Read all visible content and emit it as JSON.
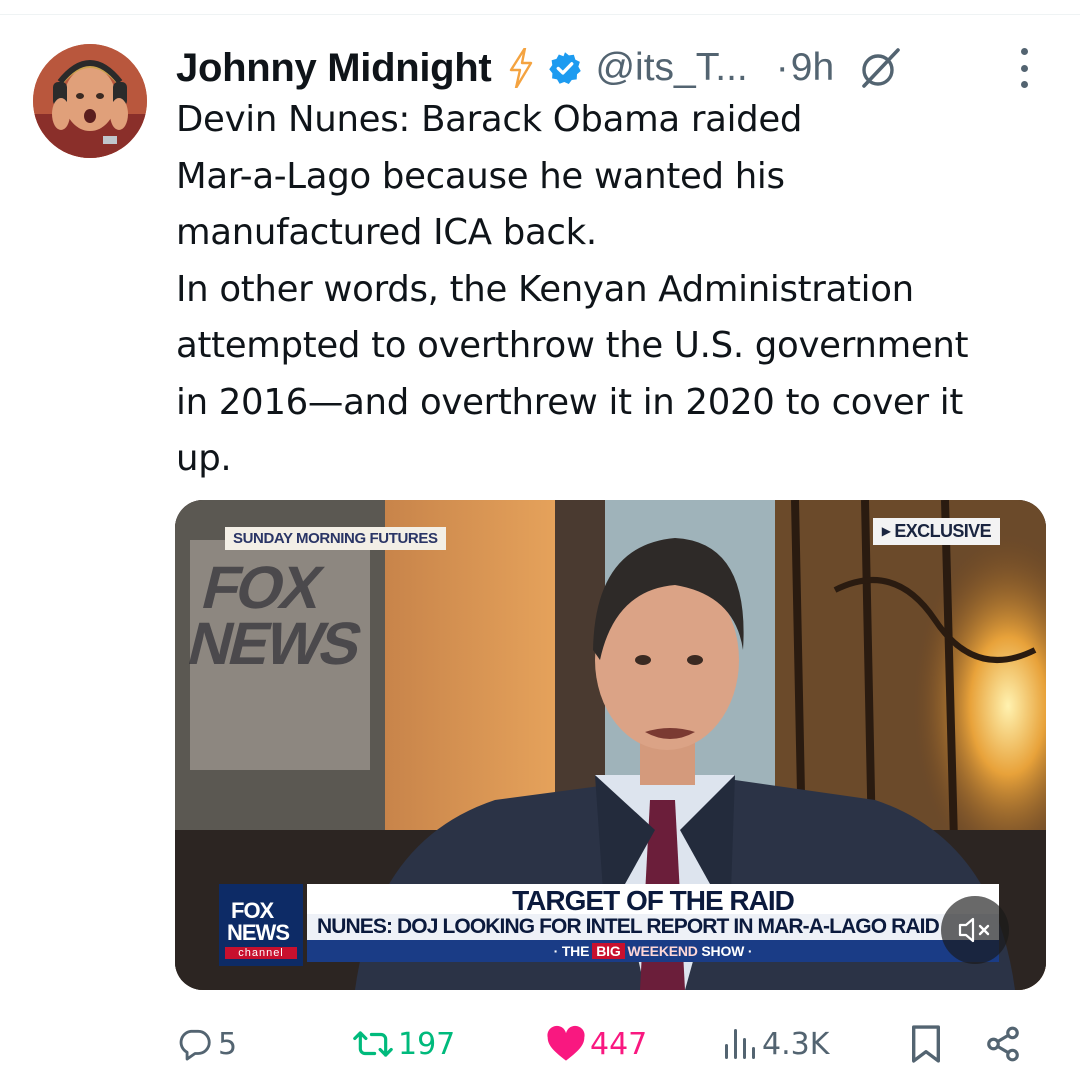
{
  "tweet": {
    "author_name": "Johnny Midnight",
    "handle": "@its_T...",
    "separator": "·",
    "time": "9h",
    "text": "Devin Nunes: Barack Obama raided\nMar-a-Lago because he wanted his\nmanufactured ICA back.\nIn other words, the Kenyan Administration\nattempted to overthrow the U.S. government\nin 2016—and overthrew it in 2020 to cover it\nup."
  },
  "media": {
    "show_tag": "SUNDAY MORNING FUTURES",
    "exclusive": "EXCLUSIVE",
    "wall_logo_line1": "FOX",
    "wall_logo_line2": "NEWS",
    "chyron_logo_line1": "FOX",
    "chyron_logo_line2": "NEWS",
    "chyron_logo_line3": "channel",
    "headline": "TARGET OF THE RAID",
    "subheadline": "NUNES: DOJ LOOKING FOR INTEL REPORT IN MAR-A-LAGO RAID",
    "ticker_prefix": "· THE",
    "ticker_big": "BIG",
    "ticker_weekend": "WEEKEND",
    "ticker_suffix": "SHOW ·"
  },
  "actions": {
    "replies": "5",
    "reposts": "197",
    "likes": "447",
    "views": "4.3K"
  },
  "icons": {
    "premium": "lightning-bolt-icon",
    "verified": "verified-badge-icon",
    "grok": "grok-icon",
    "more": "more-options-icon",
    "mute": "muted-speaker-icon",
    "reply": "reply-icon",
    "repost": "repost-icon",
    "like": "heart-icon",
    "views": "views-icon",
    "bookmark": "bookmark-icon",
    "share": "share-icon"
  },
  "colors": {
    "text": "#0f1419",
    "secondary": "#536471",
    "repost": "#00ba7c",
    "like": "#f91880",
    "verified": "#1d9bf0",
    "premium": "#f4a340"
  }
}
